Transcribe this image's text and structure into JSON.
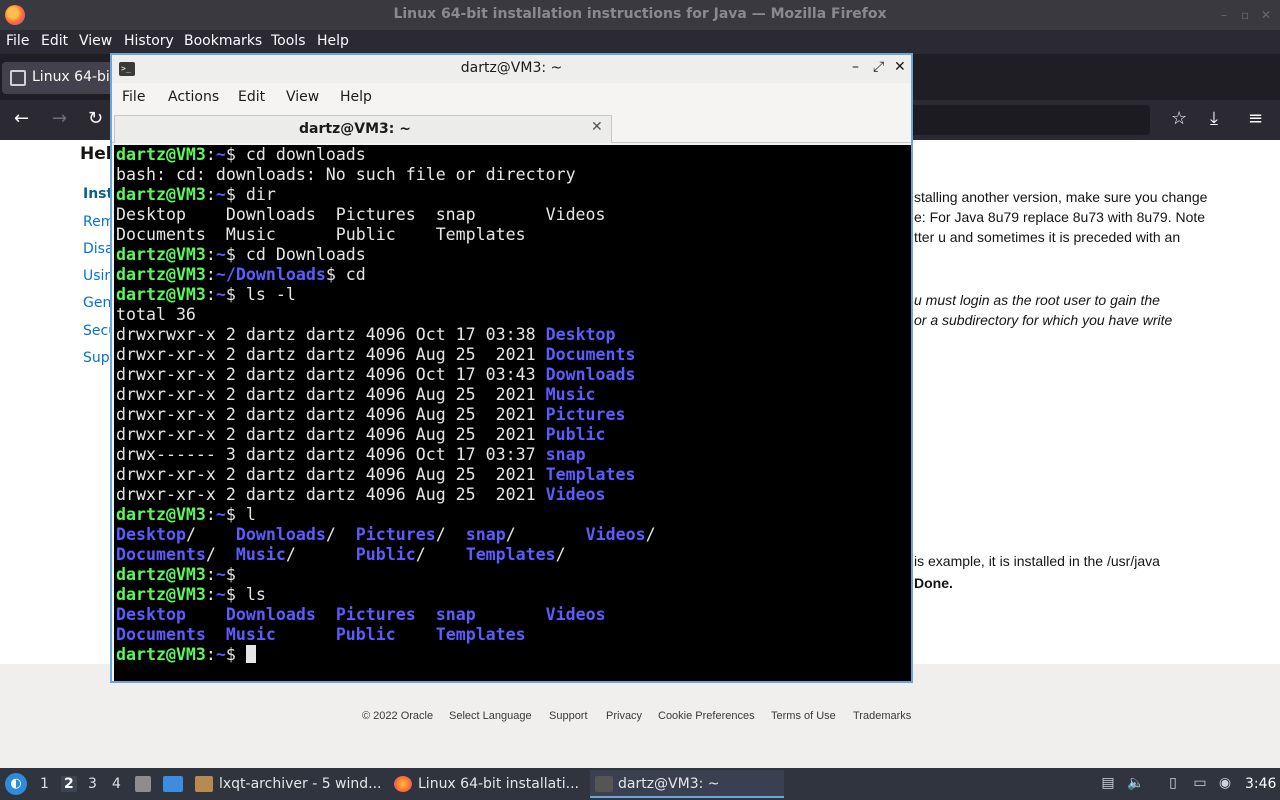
{
  "firefox": {
    "window_title": "Linux 64-bit installation instructions for Java — Mozilla Firefox",
    "minimize": "–",
    "maximize": "▫",
    "close": "✕",
    "menus": [
      "File",
      "Edit",
      "View",
      "History",
      "Bookmarks",
      "Tools",
      "Help"
    ],
    "tab_label": "Linux 64-bit",
    "nav": {
      "back": "←",
      "forward": "→",
      "reload": "↻",
      "bookmark": "☆",
      "download": "⤓",
      "menu": "≡"
    }
  },
  "page": {
    "heading": "Hel",
    "sidebar": [
      "Inst",
      "Rem",
      "Disa",
      "Usin",
      "Gen",
      "Secu",
      "Sup"
    ],
    "text_lines": [
      "stalling another version, make sure you change",
      "e: For Java 8u79 replace 8u73 with 8u79. Note",
      "tter u and sometimes it is preceded with an",
      "u must login as the root user to gain the",
      "or a subdirectory for which you have write",
      "is example, it is installed in the /usr/java",
      "Done."
    ],
    "footer": [
      "© 2022 Oracle",
      "Select Language",
      "Support",
      "Privacy",
      "Cookie Preferences",
      "Terms of Use",
      "Trademarks"
    ]
  },
  "terminal": {
    "window_title": "dartz@VM3: ~",
    "minimize": "–",
    "maximize": "⤢",
    "close": "✕",
    "menus": [
      "File",
      "Actions",
      "Edit",
      "View",
      "Help"
    ],
    "tab_label": "dartz@VM3: ~",
    "tab_close": "✕",
    "lines": [
      [
        {
          "t": "dartz@VM3",
          "c": "prompt"
        },
        {
          "t": ":"
        },
        {
          "t": "~",
          "c": "path"
        },
        {
          "t": "$ cd downloads"
        }
      ],
      [
        {
          "t": "bash: cd: downloads: No such file or directory"
        }
      ],
      [
        {
          "t": "dartz@VM3",
          "c": "prompt"
        },
        {
          "t": ":"
        },
        {
          "t": "~",
          "c": "path"
        },
        {
          "t": "$ dir"
        }
      ],
      [
        {
          "t": "Desktop    Downloads  Pictures  snap       Videos"
        }
      ],
      [
        {
          "t": "Documents  Music      Public    Templates"
        }
      ],
      [
        {
          "t": "dartz@VM3",
          "c": "prompt"
        },
        {
          "t": ":"
        },
        {
          "t": "~",
          "c": "path"
        },
        {
          "t": "$ cd Downloads"
        }
      ],
      [
        {
          "t": "dartz@VM3",
          "c": "prompt"
        },
        {
          "t": ":"
        },
        {
          "t": "~/Downloads",
          "c": "path"
        },
        {
          "t": "$ cd"
        }
      ],
      [
        {
          "t": "dartz@VM3",
          "c": "prompt"
        },
        {
          "t": ":"
        },
        {
          "t": "~",
          "c": "path"
        },
        {
          "t": "$ ls -l"
        }
      ],
      [
        {
          "t": "total 36"
        }
      ],
      [
        {
          "t": "drwxrwxr-x 2 dartz dartz 4096 Oct 17 03:38 "
        },
        {
          "t": "Desktop",
          "c": "dir"
        }
      ],
      [
        {
          "t": "drwxr-xr-x 2 dartz dartz 4096 Aug 25  2021 "
        },
        {
          "t": "Documents",
          "c": "dir"
        }
      ],
      [
        {
          "t": "drwxr-xr-x 2 dartz dartz 4096 Oct 17 03:43 "
        },
        {
          "t": "Downloads",
          "c": "dir"
        }
      ],
      [
        {
          "t": "drwxr-xr-x 2 dartz dartz 4096 Aug 25  2021 "
        },
        {
          "t": "Music",
          "c": "dir"
        }
      ],
      [
        {
          "t": "drwxr-xr-x 2 dartz dartz 4096 Aug 25  2021 "
        },
        {
          "t": "Pictures",
          "c": "dir"
        }
      ],
      [
        {
          "t": "drwxr-xr-x 2 dartz dartz 4096 Aug 25  2021 "
        },
        {
          "t": "Public",
          "c": "dir"
        }
      ],
      [
        {
          "t": "drwx------ 3 dartz dartz 4096 Oct 17 03:37 "
        },
        {
          "t": "snap",
          "c": "dir"
        }
      ],
      [
        {
          "t": "drwxr-xr-x 2 dartz dartz 4096 Aug 25  2021 "
        },
        {
          "t": "Templates",
          "c": "dir"
        }
      ],
      [
        {
          "t": "drwxr-xr-x 2 dartz dartz 4096 Aug 25  2021 "
        },
        {
          "t": "Videos",
          "c": "dir"
        }
      ],
      [
        {
          "t": "dartz@VM3",
          "c": "prompt"
        },
        {
          "t": ":"
        },
        {
          "t": "~",
          "c": "path"
        },
        {
          "t": "$ l"
        }
      ],
      [
        {
          "t": "Desktop",
          "c": "dir"
        },
        {
          "t": "/    "
        },
        {
          "t": "Downloads",
          "c": "dir"
        },
        {
          "t": "/  "
        },
        {
          "t": "Pictures",
          "c": "dir"
        },
        {
          "t": "/  "
        },
        {
          "t": "snap",
          "c": "dir"
        },
        {
          "t": "/       "
        },
        {
          "t": "Videos",
          "c": "dir"
        },
        {
          "t": "/"
        }
      ],
      [
        {
          "t": "Documents",
          "c": "dir"
        },
        {
          "t": "/  "
        },
        {
          "t": "Music",
          "c": "dir"
        },
        {
          "t": "/      "
        },
        {
          "t": "Public",
          "c": "dir"
        },
        {
          "t": "/    "
        },
        {
          "t": "Templates",
          "c": "dir"
        },
        {
          "t": "/"
        }
      ],
      [
        {
          "t": "dartz@VM3",
          "c": "prompt"
        },
        {
          "t": ":"
        },
        {
          "t": "~",
          "c": "path"
        },
        {
          "t": "$"
        }
      ],
      [
        {
          "t": "dartz@VM3",
          "c": "prompt"
        },
        {
          "t": ":"
        },
        {
          "t": "~",
          "c": "path"
        },
        {
          "t": "$ ls"
        }
      ],
      [
        {
          "t": "Desktop",
          "c": "dir"
        },
        {
          "t": "    "
        },
        {
          "t": "Downloads",
          "c": "dir"
        },
        {
          "t": "  "
        },
        {
          "t": "Pictures",
          "c": "dir"
        },
        {
          "t": "  "
        },
        {
          "t": "snap",
          "c": "dir"
        },
        {
          "t": "       "
        },
        {
          "t": "Videos",
          "c": "dir"
        }
      ],
      [
        {
          "t": "Documents",
          "c": "dir"
        },
        {
          "t": "  "
        },
        {
          "t": "Music",
          "c": "dir"
        },
        {
          "t": "      "
        },
        {
          "t": "Public",
          "c": "dir"
        },
        {
          "t": "    "
        },
        {
          "t": "Templates",
          "c": "dir"
        }
      ],
      [
        {
          "t": "dartz@VM3",
          "c": "prompt"
        },
        {
          "t": ":"
        },
        {
          "t": "~",
          "c": "path"
        },
        {
          "t": "$ "
        }
      ]
    ]
  },
  "taskbar": {
    "desktops": [
      "1",
      "2",
      "3",
      "4"
    ],
    "current_desktop": "2",
    "apps": [
      {
        "label": "lxqt-archiver - 5 wind...",
        "icon": "archiver-icon"
      },
      {
        "label": "Linux 64-bit installati...",
        "icon": "firefox-icon"
      },
      {
        "label": "dartz@VM3: ~",
        "icon": "terminal-icon"
      }
    ],
    "clock": "3:46"
  },
  "colors": {
    "prompt": "#5cf75c",
    "directory": "#5c5cff",
    "terminal_bg": "#000000",
    "active_border": "#6ca6d9"
  }
}
